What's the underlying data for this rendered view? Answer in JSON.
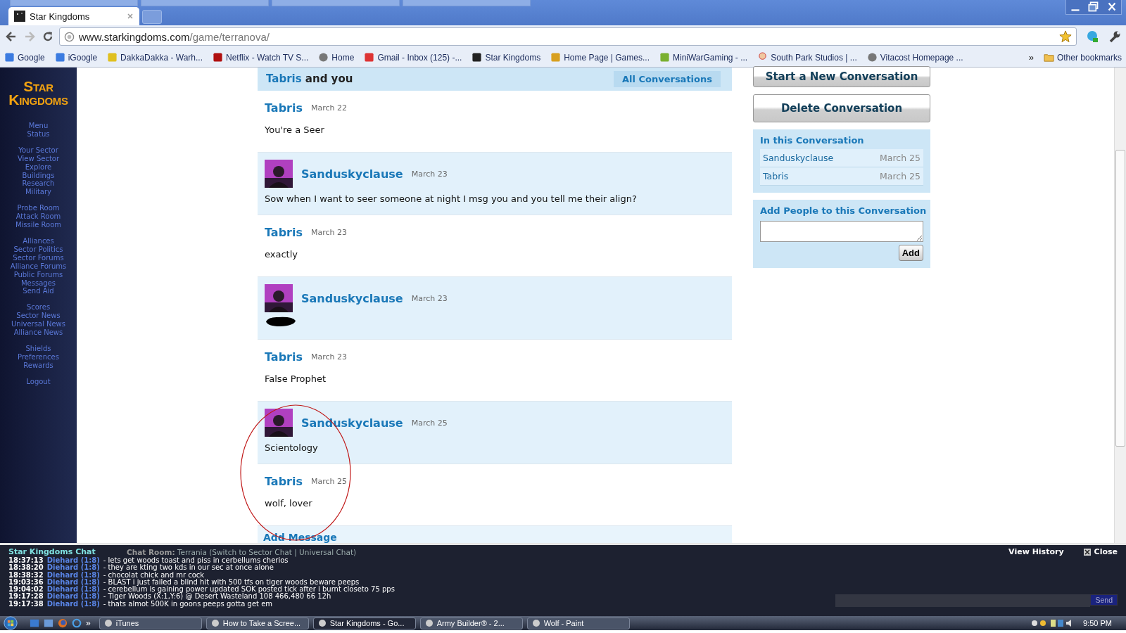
{
  "browser": {
    "tabs": [
      {
        "title": "Star Kingdoms",
        "selected": true
      }
    ],
    "url_host": "www.starkingdoms.com",
    "url_path": "/game/terranova/",
    "bookmarks": [
      {
        "label": "Google"
      },
      {
        "label": "iGoogle"
      },
      {
        "label": "DakkaDakka - Warh..."
      },
      {
        "label": "Netflix - Watch TV S..."
      },
      {
        "label": "Home"
      },
      {
        "label": "Gmail - Inbox (125) -..."
      },
      {
        "label": "Star Kingdoms"
      },
      {
        "label": "Home Page | Games..."
      },
      {
        "label": "MiniWarGaming - ..."
      },
      {
        "label": "South Park Studios | ..."
      },
      {
        "label": "Vitacost Homepage ..."
      }
    ],
    "overflow": "»",
    "other_bookmarks": "Other bookmarks"
  },
  "sidebar": {
    "logo_top": "STAR",
    "logo_bottom": "KINGDOMS",
    "groups": [
      [
        "Menu",
        "Status"
      ],
      [
        "Your Sector",
        "View Sector",
        "Explore",
        "Buildings",
        "Research",
        "Military"
      ],
      [
        "Probe Room",
        "Attack Room",
        "Missile Room"
      ],
      [
        "Alliances",
        "Sector Politics",
        "Sector Forums",
        "Alliance Forums",
        "Public Forums",
        "Messages",
        "Send Aid"
      ],
      [
        "Scores",
        "Sector News",
        "Universal News",
        "Alliance News"
      ],
      [
        "Shields",
        "Preferences",
        "Rewards"
      ],
      [
        "Logout"
      ]
    ]
  },
  "conversation": {
    "with": "Tabris",
    "title_rest": "and you",
    "all_link": "All Conversations",
    "add_message": "Add Message",
    "messages": [
      {
        "kind": "plain",
        "author": "Tabris",
        "date": "March 22",
        "text": "You're a Seer"
      },
      {
        "kind": "avatar",
        "author": "Sanduskyclause",
        "date": "March 23",
        "text": "Sow when I want to seer someone at night I msg you and you tell me their align?"
      },
      {
        "kind": "plain",
        "author": "Tabris",
        "date": "March 23",
        "text": "exactly"
      },
      {
        "kind": "avatar",
        "author": "Sanduskyclause",
        "date": "March 23",
        "redacted": true
      },
      {
        "kind": "plain",
        "author": "Tabris",
        "date": "March 23",
        "text": "False Prophet"
      },
      {
        "kind": "avatar",
        "author": "Sanduskyclause",
        "date": "March 25",
        "text": "Scientology"
      },
      {
        "kind": "plain",
        "author": "Tabris",
        "date": "March 25",
        "text": "wolf, lover"
      }
    ],
    "annotations": [
      {
        "kind": "ellipse"
      }
    ]
  },
  "side": {
    "buttons": [
      "Start a New Conversation",
      "Delete Conversation"
    ],
    "participants_title": "In this Conversation",
    "participants": [
      {
        "name": "Sanduskyclause",
        "date": "March 25"
      },
      {
        "name": "Tabris",
        "date": "March 25"
      }
    ],
    "add_title": "Add People to this Conversation",
    "add_button": "Add"
  },
  "chat": {
    "title": "Star Kingdoms Chat",
    "room_label": "Chat Room:",
    "room": "Terrania (Switch to Sector Chat | Universal Chat)",
    "history": "View History",
    "close": "Close",
    "send": "Send",
    "lines": [
      {
        "time": "18:37:13",
        "user": "Diehard (1:8)",
        "text": "- lets get woods toast and piss in cerbellums cherios"
      },
      {
        "time": "18:38:20",
        "user": "Diehard (1:8)",
        "text": "- they are kting two kds in our sec at once alone"
      },
      {
        "time": "18:38:32",
        "user": "Diehard (1:8)",
        "text": "- chocolat chick and mr cock"
      },
      {
        "time": "19:03:36",
        "user": "Diehard (1:8)",
        "text": "- BLAST i just failed a blind hit with 500 tfs on tiger woods beware peeps"
      },
      {
        "time": "19:04:02",
        "user": "Diehard (1:8)",
        "text": "- cerebellum is gaining power updated SOK posted tick after i burnt closeto 75 pps"
      },
      {
        "time": "19:17:28",
        "user": "Diehard (1:8)",
        "text": "- Tiger Woods (X:1,Y:6) @ Desert Wasteland 108 466,480 66 12h"
      },
      {
        "time": "19:17:38",
        "user": "Diehard (1:8)",
        "text": "- thats almot 500K in goons peeps gotta get em"
      }
    ]
  },
  "taskbar": {
    "overflow": "»",
    "items": [
      {
        "label": "iTunes",
        "selected": false
      },
      {
        "label": "How to Take a Scree...",
        "selected": false
      },
      {
        "label": "Star Kingdoms - Go...",
        "selected": true
      },
      {
        "label": "Army Builder® - 2...",
        "selected": false
      },
      {
        "label": "Wolf - Paint",
        "selected": false
      }
    ],
    "clock": "9:50 PM"
  }
}
